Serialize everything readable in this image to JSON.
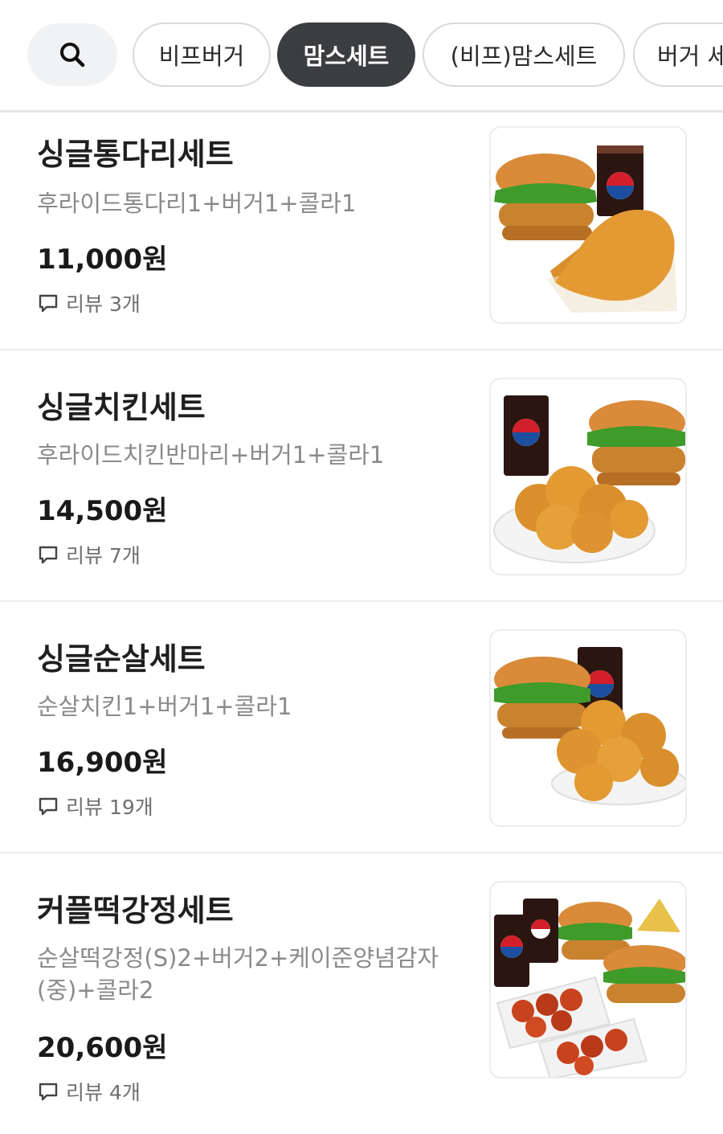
{
  "categories": {
    "chips": [
      {
        "label": "비프버거",
        "active": false
      },
      {
        "label": "맘스세트",
        "active": true
      },
      {
        "label": "(비프)맘스세트",
        "active": false
      },
      {
        "label": "버거 세",
        "active": false
      }
    ]
  },
  "menu": {
    "items": [
      {
        "name": "싱글통다리세트",
        "description": "후라이드통다리1+버거1+콜라1",
        "price": "11,000원",
        "review": "리뷰 3개"
      },
      {
        "name": "싱글치킨세트",
        "description": "후라이드치킨반마리+버거1+콜라1",
        "price": "14,500원",
        "review": "리뷰 7개"
      },
      {
        "name": "싱글순살세트",
        "description": "순살치킨1+버거1+콜라1",
        "price": "16,900원",
        "review": "리뷰 19개"
      },
      {
        "name": "커플떡강정세트",
        "description": "순살떡강정(S)2+버거2+케이준양념감자(중)+콜라2",
        "price": "20,600원",
        "review": "리뷰 4개"
      }
    ]
  },
  "icons": {
    "search": "search-icon",
    "review": "speech-bubble-icon"
  },
  "colors": {
    "active_chip": "#3b3d40",
    "chip_border": "#d9d9d9",
    "description": "#8a8a8a"
  }
}
